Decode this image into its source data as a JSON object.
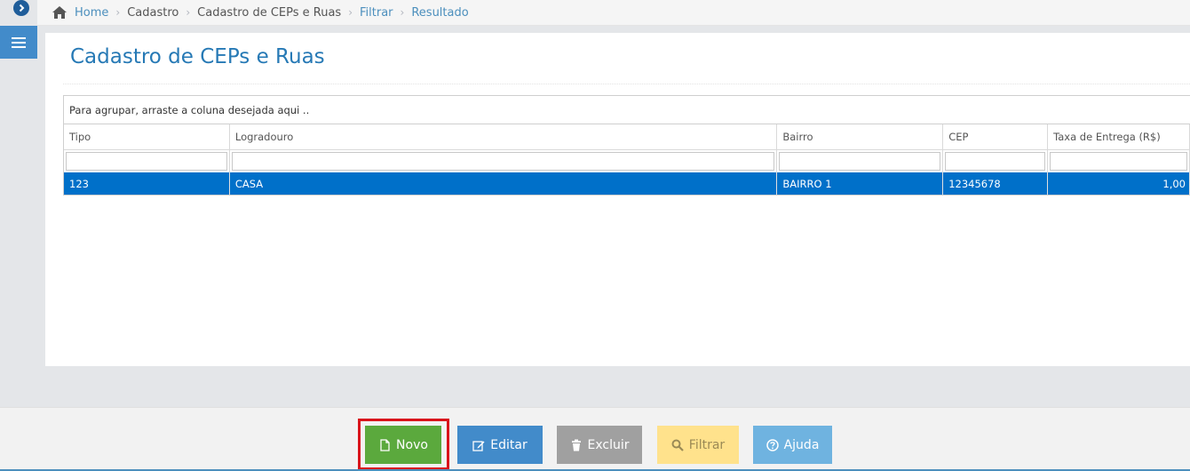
{
  "breadcrumb": {
    "home": "Home",
    "items": [
      "Cadastro",
      "Cadastro de CEPs e Ruas",
      "Filtrar",
      "Resultado"
    ]
  },
  "page": {
    "title": "Cadastro de CEPs e Ruas"
  },
  "grid": {
    "group_hint": "Para agrupar, arraste a coluna desejada aqui ..",
    "columns": [
      "Tipo",
      "Logradouro",
      "Bairro",
      "CEP",
      "Taxa de Entrega (R$)"
    ],
    "rows": [
      {
        "tipo": "123",
        "logradouro": "CASA",
        "bairro": "BAIRRO 1",
        "cep": "12345678",
        "taxa": "1,00"
      }
    ]
  },
  "toolbar": {
    "novo": "Novo",
    "editar": "Editar",
    "excluir": "Excluir",
    "filtrar": "Filtrar",
    "ajuda": "Ajuda"
  },
  "icons": {
    "expand": "chevron-right-circle-icon",
    "menu": "hamburger-menu-icon",
    "home": "home-icon",
    "novo": "file-icon",
    "editar": "edit-icon",
    "excluir": "trash-icon",
    "filtrar": "search-icon",
    "ajuda": "question-circle-icon"
  },
  "colors": {
    "accent": "#428bca",
    "selected_row": "#0070c9",
    "novo": "#5ba93d",
    "excluir": "#a0a0a0",
    "filtrar": "#ffe28c",
    "ajuda": "#6fb3e0",
    "highlight": "#d9141b"
  }
}
